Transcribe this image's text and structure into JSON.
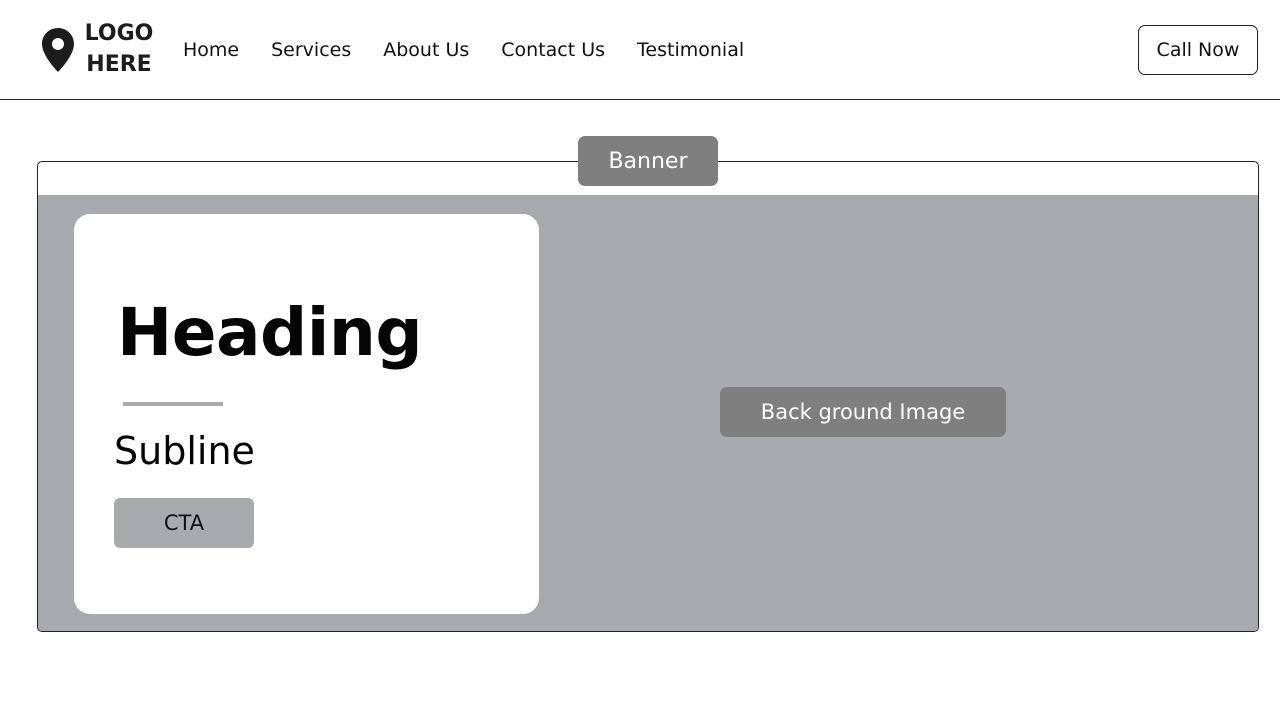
{
  "header": {
    "logo": {
      "line1": "LOGO",
      "line2": "HERE",
      "icon": "map-pin-icon"
    },
    "nav": [
      {
        "label": "Home"
      },
      {
        "label": "Services"
      },
      {
        "label": "About Us"
      },
      {
        "label": "Contact Us"
      },
      {
        "label": "Testimonial"
      }
    ],
    "call_label": "Call Now"
  },
  "banner": {
    "tag": "Banner",
    "card": {
      "heading": "Heading",
      "subline": "Subline",
      "cta_label": "CTA"
    },
    "background_tag": "Back ground Image"
  },
  "colors": {
    "banner_bg": "#a9aaad",
    "tag_bg": "#7f7f7f",
    "text": "#111111",
    "border": "#222222"
  }
}
